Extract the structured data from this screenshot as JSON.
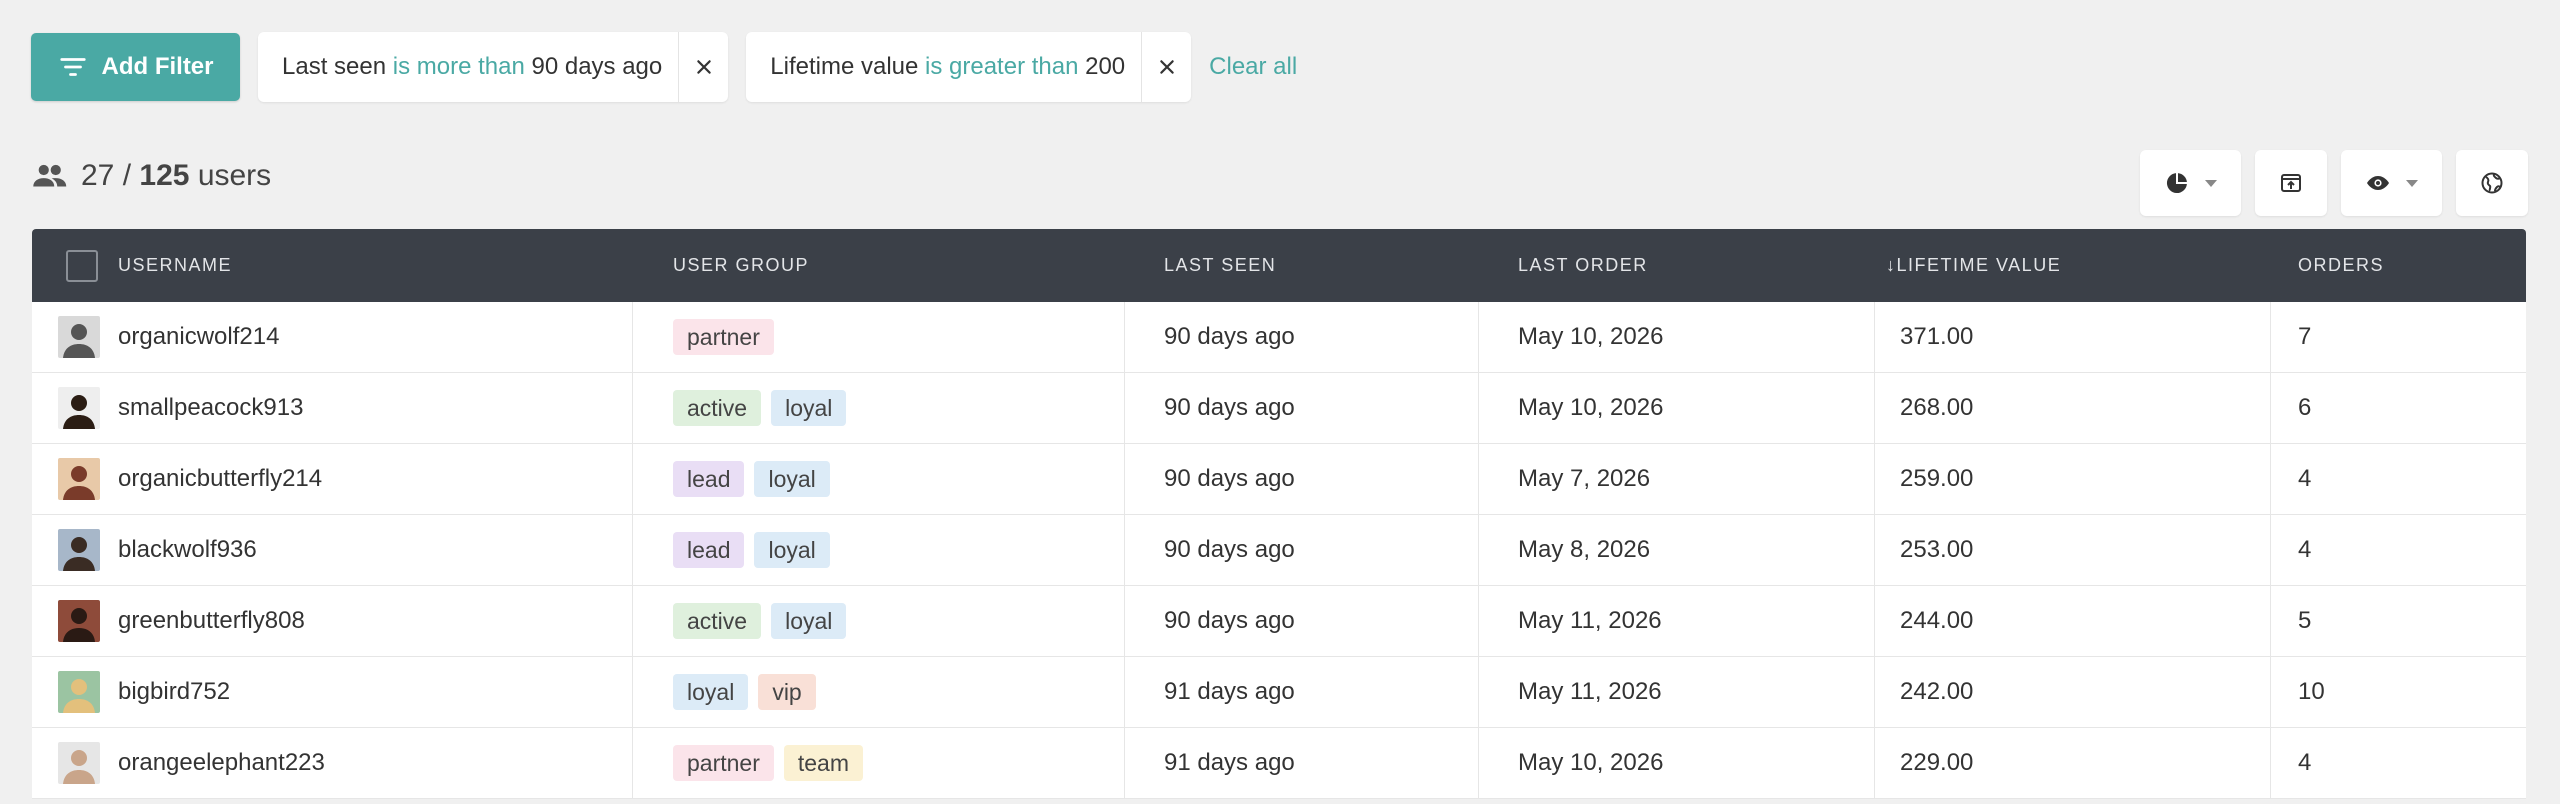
{
  "filters": {
    "add_label": "Add Filter",
    "chips": [
      {
        "field": "Last seen",
        "operator": "is more than",
        "value": "90 days ago"
      },
      {
        "field": "Lifetime value",
        "operator": "is greater than",
        "value": "200"
      }
    ],
    "clear_label": "Clear all"
  },
  "summary": {
    "shown": "27",
    "separator": "/",
    "total": "125",
    "unit": "users"
  },
  "toolbar": [
    {
      "icon": "pie-chart-icon",
      "has_dropdown": true
    },
    {
      "icon": "export-icon",
      "has_dropdown": false
    },
    {
      "icon": "eye-icon",
      "has_dropdown": true
    },
    {
      "icon": "globe-icon",
      "has_dropdown": false
    }
  ],
  "table": {
    "columns": [
      "Username",
      "User Group",
      "Last Seen",
      "Last Order",
      "↓Lifetime Value",
      "Orders"
    ],
    "rows": [
      {
        "username": "organicwolf214",
        "groups": [
          "partner"
        ],
        "last_seen": "90 days ago",
        "last_order": "May 10, 2026",
        "lifetime_value": "371.00",
        "orders": "7"
      },
      {
        "username": "smallpeacock913",
        "groups": [
          "active",
          "loyal"
        ],
        "last_seen": "90 days ago",
        "last_order": "May 10, 2026",
        "lifetime_value": "268.00",
        "orders": "6"
      },
      {
        "username": "organicbutterfly214",
        "groups": [
          "lead",
          "loyal"
        ],
        "last_seen": "90 days ago",
        "last_order": "May 7, 2026",
        "lifetime_value": "259.00",
        "orders": "4"
      },
      {
        "username": "blackwolf936",
        "groups": [
          "lead",
          "loyal"
        ],
        "last_seen": "90 days ago",
        "last_order": "May 8, 2026",
        "lifetime_value": "253.00",
        "orders": "4"
      },
      {
        "username": "greenbutterfly808",
        "groups": [
          "active",
          "loyal"
        ],
        "last_seen": "90 days ago",
        "last_order": "May 11, 2026",
        "lifetime_value": "244.00",
        "orders": "5"
      },
      {
        "username": "bigbird752",
        "groups": [
          "loyal",
          "vip"
        ],
        "last_seen": "91 days ago",
        "last_order": "May 11, 2026",
        "lifetime_value": "242.00",
        "orders": "10"
      },
      {
        "username": "orangeelephant223",
        "groups": [
          "partner",
          "team"
        ],
        "last_seen": "91 days ago",
        "last_order": "May 10, 2026",
        "lifetime_value": "229.00",
        "orders": "4"
      }
    ]
  },
  "colors": {
    "accent": "#4aa9a4",
    "header_bg": "#3b4048"
  }
}
